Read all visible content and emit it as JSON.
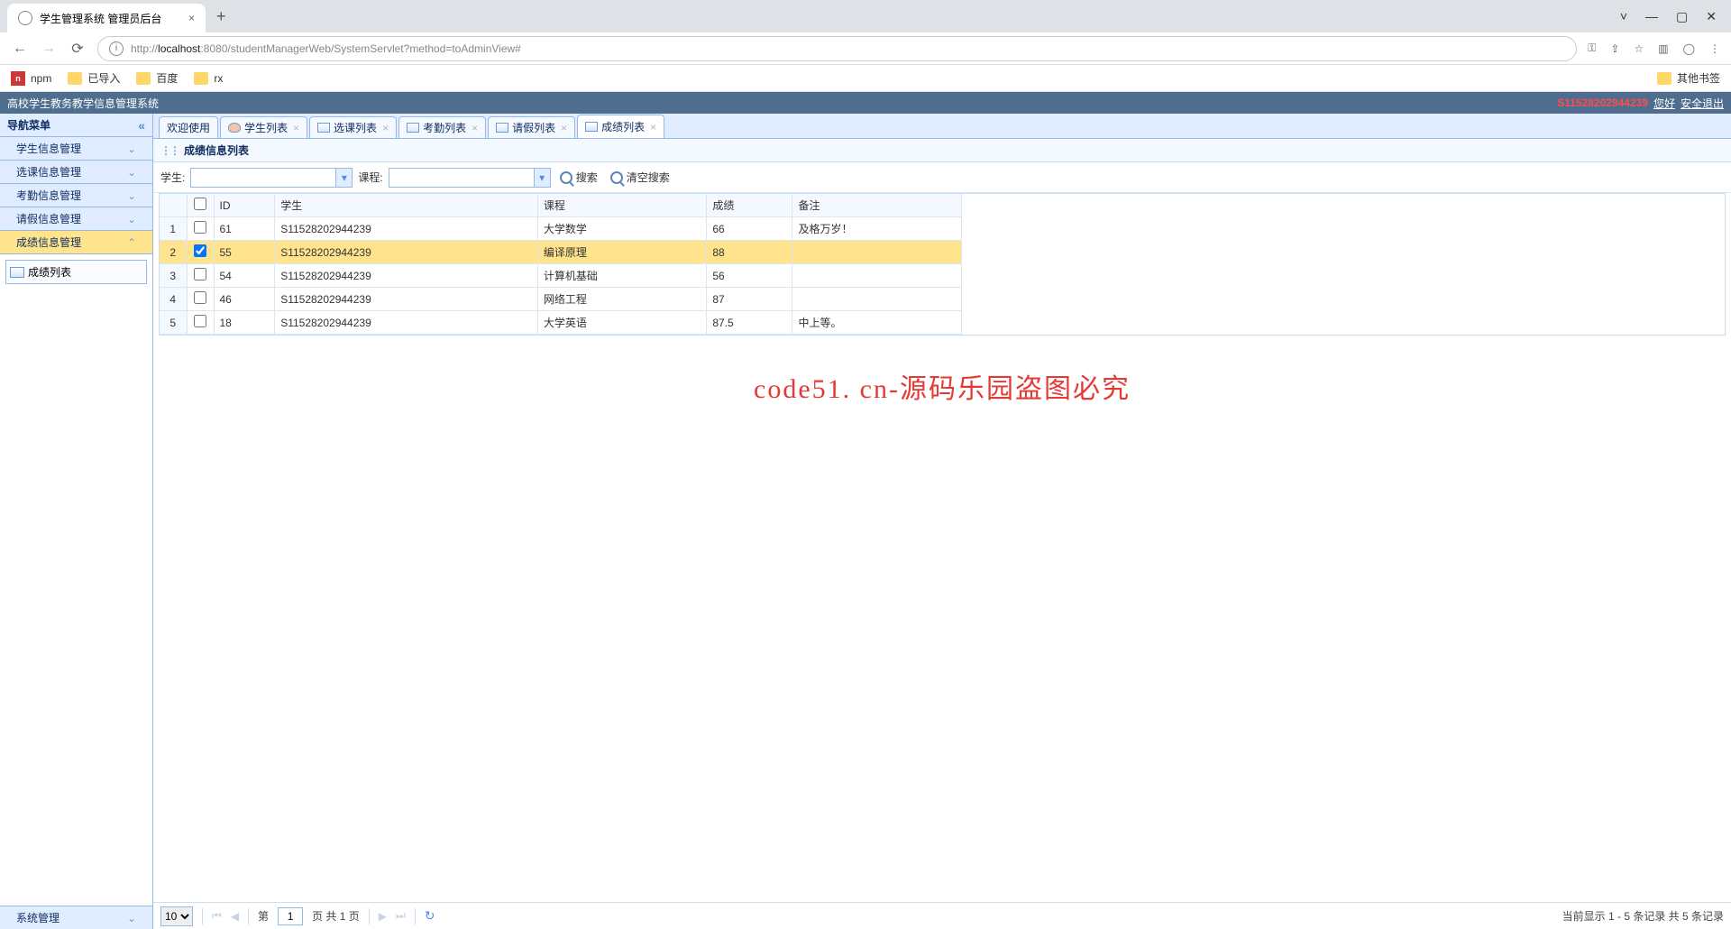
{
  "browser": {
    "tab_title": "学生管理系统 管理员后台",
    "url_prefix": "http://",
    "url_host": "localhost",
    "url_port_path": ":8080/studentManagerWeb/SystemServlet?method=toAdminView#",
    "bookmarks": {
      "npm": "npm",
      "imported": "已导入",
      "baidu": "百度",
      "rx": "rx",
      "other": "其他书签"
    }
  },
  "app": {
    "title": "高校学生教务教学信息管理系统",
    "user_id": "S11528202944239",
    "greeting": "您好",
    "logout": "安全退出"
  },
  "sidebar": {
    "title": "导航菜单",
    "items": [
      "学生信息管理",
      "选课信息管理",
      "考勤信息管理",
      "请假信息管理",
      "成绩信息管理"
    ],
    "active_index": 4,
    "tree_node": "成绩列表",
    "footer": "系统管理"
  },
  "tabs": [
    {
      "label": "欢迎使用",
      "closable": false,
      "icon": "none"
    },
    {
      "label": "学生列表",
      "closable": true,
      "icon": "person"
    },
    {
      "label": "选课列表",
      "closable": true,
      "icon": "book"
    },
    {
      "label": "考勤列表",
      "closable": true,
      "icon": "book"
    },
    {
      "label": "请假列表",
      "closable": true,
      "icon": "book"
    },
    {
      "label": "成绩列表",
      "closable": true,
      "icon": "book",
      "active": true
    }
  ],
  "panel": {
    "title": "成绩信息列表"
  },
  "toolbar": {
    "student_label": "学生:",
    "course_label": "课程:",
    "search": "搜索",
    "clear": "清空搜索"
  },
  "grid": {
    "columns": [
      "ID",
      "学生",
      "课程",
      "成绩",
      "备注"
    ],
    "rows": [
      {
        "n": 1,
        "checked": false,
        "id": "61",
        "student": "S11528202944239",
        "course": "大学数学",
        "score": "66",
        "remark": "及格万岁！"
      },
      {
        "n": 2,
        "checked": true,
        "id": "55",
        "student": "S11528202944239",
        "course": "编译原理",
        "score": "88",
        "remark": ""
      },
      {
        "n": 3,
        "checked": false,
        "id": "54",
        "student": "S11528202944239",
        "course": "计算机基础",
        "score": "56",
        "remark": ""
      },
      {
        "n": 4,
        "checked": false,
        "id": "46",
        "student": "S11528202944239",
        "course": "网络工程",
        "score": "87",
        "remark": ""
      },
      {
        "n": 5,
        "checked": false,
        "id": "18",
        "student": "S11528202944239",
        "course": "大学英语",
        "score": "87.5",
        "remark": "中上等。"
      }
    ]
  },
  "pager": {
    "page_size": "10",
    "page_label_pre": "第",
    "page": "1",
    "page_label_post": "页 共 1 页",
    "info": "当前显示 1 - 5 条记录 共 5 条记录"
  },
  "watermark": "code51. cn-源码乐园盗图必究"
}
